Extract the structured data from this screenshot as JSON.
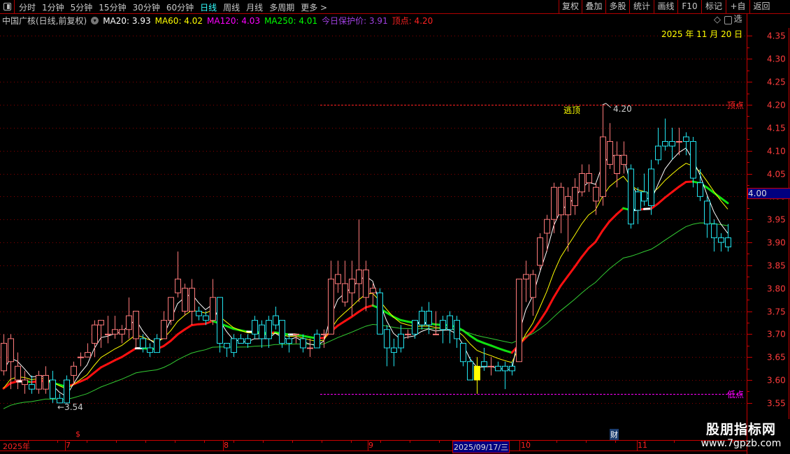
{
  "toolbar": {
    "tabs": [
      "分时",
      "1分钟",
      "5分钟",
      "15分钟",
      "30分钟",
      "60分钟",
      "日线",
      "周线",
      "月线",
      "多周期",
      "更多 >"
    ],
    "active_tab": "日线",
    "right_buttons": [
      "复权",
      "叠加",
      "多股",
      "统计",
      "画线",
      "F10",
      "标记",
      "+自选",
      "返回"
    ]
  },
  "info": {
    "title": "中国广核(日线,前复权)",
    "ma20": "MA20: 3.93",
    "ma60": "MA60: 4.02",
    "ma120": "MA120: 4.03",
    "ma250": "MA250: 4.01",
    "protect": "今日保护价: 3.91",
    "top": "顶点: 4.20"
  },
  "colors": {
    "up": "#ff7a7a",
    "down": "#22e5f0",
    "ma_white": "#ffffff",
    "ma_yellow": "#ffff00",
    "ma_green": "#33cc33",
    "axis": "#ff3c3c",
    "grid": "#8b0000"
  },
  "date_label": "2025 年 11 月 20 日",
  "annotations": {
    "escape_top": "逃顶",
    "high_value": "4.20",
    "top_point": "顶点",
    "low_point": "低点",
    "low_value": "←3.54"
  },
  "axis": {
    "current_price": "4.00",
    "time_labels": [
      "2025年",
      "7",
      "8",
      "9",
      "10",
      "11"
    ],
    "cursor_date": "2025/09/17/三",
    "marker_dollar": "$",
    "marker_finance": "财"
  },
  "watermark": {
    "name": "股朋指标网",
    "url": "www.7gpzb.com"
  },
  "chart_data": {
    "type": "candlestick",
    "ylim": [
      3.53,
      4.37
    ],
    "yticks": [
      3.55,
      3.6,
      3.65,
      3.7,
      3.75,
      3.8,
      3.85,
      3.9,
      3.95,
      4.0,
      4.05,
      4.1,
      4.15,
      4.2,
      4.25,
      4.3,
      4.35
    ],
    "top_line": 4.2,
    "low_line": 3.57,
    "highlight_index": 68,
    "ohlc": [
      [
        3.62,
        3.7,
        3.61,
        3.68
      ],
      [
        3.64,
        3.7,
        3.58,
        3.69
      ],
      [
        3.6,
        3.66,
        3.58,
        3.63
      ],
      [
        3.59,
        3.62,
        3.57,
        3.6
      ],
      [
        3.59,
        3.61,
        3.57,
        3.58
      ],
      [
        3.58,
        3.62,
        3.57,
        3.61
      ],
      [
        3.58,
        3.63,
        3.57,
        3.61
      ],
      [
        3.6,
        3.62,
        3.55,
        3.56
      ],
      [
        3.56,
        3.57,
        3.55,
        3.55
      ],
      [
        3.6,
        3.61,
        3.55,
        3.55
      ],
      [
        3.61,
        3.64,
        3.59,
        3.63
      ],
      [
        3.65,
        3.66,
        3.63,
        3.65
      ],
      [
        3.65,
        3.68,
        3.65,
        3.66
      ],
      [
        3.68,
        3.73,
        3.65,
        3.72
      ],
      [
        3.72,
        3.73,
        3.67,
        3.73
      ],
      [
        3.7,
        3.74,
        3.68,
        3.7
      ],
      [
        3.7,
        3.74,
        3.69,
        3.71
      ],
      [
        3.7,
        3.72,
        3.68,
        3.71
      ],
      [
        3.71,
        3.78,
        3.69,
        3.74
      ],
      [
        3.69,
        3.75,
        3.67,
        3.75
      ],
      [
        3.69,
        3.7,
        3.66,
        3.67
      ],
      [
        3.67,
        3.68,
        3.65,
        3.66
      ],
      [
        3.69,
        3.7,
        3.66,
        3.66
      ],
      [
        3.69,
        3.75,
        3.69,
        3.73
      ],
      [
        3.73,
        3.78,
        3.72,
        3.78
      ],
      [
        3.79,
        3.88,
        3.78,
        3.82
      ],
      [
        3.75,
        3.81,
        3.74,
        3.8
      ],
      [
        3.75,
        3.82,
        3.72,
        3.8
      ],
      [
        3.75,
        3.76,
        3.73,
        3.74
      ],
      [
        3.74,
        3.75,
        3.72,
        3.73
      ],
      [
        3.73,
        3.82,
        3.72,
        3.78
      ],
      [
        3.78,
        3.78,
        3.66,
        3.68
      ],
      [
        3.68,
        3.68,
        3.65,
        3.67
      ],
      [
        3.69,
        3.7,
        3.65,
        3.66
      ],
      [
        3.69,
        3.7,
        3.68,
        3.68
      ],
      [
        3.69,
        3.7,
        3.67,
        3.68
      ],
      [
        3.73,
        3.74,
        3.69,
        3.7
      ],
      [
        3.72,
        3.73,
        3.67,
        3.69
      ],
      [
        3.73,
        3.74,
        3.67,
        3.69
      ],
      [
        3.74,
        3.76,
        3.71,
        3.72
      ],
      [
        3.73,
        3.73,
        3.67,
        3.68
      ],
      [
        3.69,
        3.7,
        3.66,
        3.68
      ],
      [
        3.7,
        3.7,
        3.68,
        3.7
      ],
      [
        3.69,
        3.7,
        3.66,
        3.67
      ],
      [
        3.67,
        3.69,
        3.65,
        3.67
      ],
      [
        3.7,
        3.71,
        3.67,
        3.67
      ],
      [
        3.7,
        3.71,
        3.67,
        3.7
      ],
      [
        3.7,
        3.86,
        3.7,
        3.82
      ],
      [
        3.81,
        3.86,
        3.79,
        3.83
      ],
      [
        3.77,
        3.86,
        3.76,
        3.81
      ],
      [
        3.79,
        3.86,
        3.74,
        3.82
      ],
      [
        3.81,
        3.95,
        3.77,
        3.84
      ],
      [
        3.78,
        3.86,
        3.75,
        3.84
      ],
      [
        3.79,
        3.81,
        3.76,
        3.8
      ],
      [
        3.79,
        3.8,
        3.7,
        3.7
      ],
      [
        3.71,
        3.72,
        3.63,
        3.67
      ],
      [
        3.67,
        3.69,
        3.63,
        3.66
      ],
      [
        3.7,
        3.72,
        3.66,
        3.67
      ],
      [
        3.7,
        3.71,
        3.69,
        3.7
      ],
      [
        3.73,
        3.73,
        3.69,
        3.7
      ],
      [
        3.75,
        3.76,
        3.71,
        3.72
      ],
      [
        3.75,
        3.77,
        3.7,
        3.72
      ],
      [
        3.7,
        3.75,
        3.7,
        3.7
      ],
      [
        3.73,
        3.74,
        3.68,
        3.71
      ],
      [
        3.74,
        3.75,
        3.68,
        3.71
      ],
      [
        3.73,
        3.74,
        3.67,
        3.69
      ],
      [
        3.68,
        3.68,
        3.63,
        3.64
      ],
      [
        3.64,
        3.65,
        3.6,
        3.6
      ],
      [
        3.63,
        3.65,
        3.57,
        3.6
      ],
      [
        3.64,
        3.67,
        3.62,
        3.63
      ],
      [
        3.63,
        3.65,
        3.61,
        3.63
      ],
      [
        3.63,
        3.64,
        3.62,
        3.62
      ],
      [
        3.63,
        3.64,
        3.58,
        3.62
      ],
      [
        3.63,
        3.64,
        3.61,
        3.62
      ],
      [
        3.64,
        3.82,
        3.64,
        3.82
      ],
      [
        3.82,
        3.86,
        3.77,
        3.83
      ],
      [
        3.78,
        3.84,
        3.74,
        3.83
      ],
      [
        3.85,
        3.92,
        3.84,
        3.91
      ],
      [
        3.92,
        3.96,
        3.88,
        3.95
      ],
      [
        3.95,
        4.03,
        3.92,
        4.02
      ],
      [
        3.96,
        4.03,
        3.92,
        4.02
      ],
      [
        3.96,
        4.02,
        3.88,
        4.0
      ],
      [
        3.98,
        4.04,
        3.96,
        4.02
      ],
      [
        4.01,
        4.07,
        4.0,
        4.05
      ],
      [
        4.03,
        4.07,
        4.01,
        4.05
      ],
      [
        3.99,
        4.03,
        3.96,
        4.02
      ],
      [
        4.0,
        4.2,
        3.98,
        4.13
      ],
      [
        4.07,
        4.16,
        4.06,
        4.12
      ],
      [
        4.05,
        4.12,
        4.02,
        4.09
      ],
      [
        4.07,
        4.12,
        4.05,
        4.09
      ],
      [
        4.06,
        4.07,
        3.93,
        3.94
      ],
      [
        4.01,
        4.02,
        3.94,
        3.97
      ],
      [
        4.01,
        4.05,
        3.98,
        3.99
      ],
      [
        4.06,
        4.08,
        3.96,
        3.98
      ],
      [
        4.11,
        4.15,
        4.07,
        4.08
      ],
      [
        4.12,
        4.17,
        4.1,
        4.11
      ],
      [
        4.12,
        4.15,
        4.08,
        4.11
      ],
      [
        4.12,
        4.15,
        4.09,
        4.12
      ],
      [
        4.13,
        4.14,
        4.09,
        4.12
      ],
      [
        4.12,
        4.13,
        4.02,
        4.04
      ],
      [
        4.03,
        4.06,
        3.99,
        4.0
      ],
      [
        3.99,
        4.0,
        3.91,
        3.94
      ],
      [
        3.94,
        3.95,
        3.88,
        3.91
      ],
      [
        3.91,
        3.92,
        3.88,
        3.9
      ],
      [
        3.91,
        3.94,
        3.88,
        3.89
      ]
    ]
  }
}
